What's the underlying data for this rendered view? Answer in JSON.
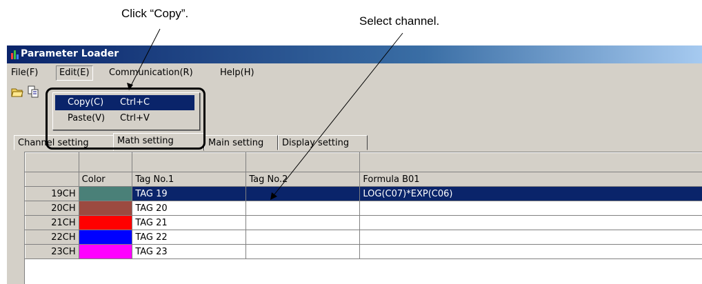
{
  "annotations": {
    "copy": "Click “Copy”.",
    "select": "Select channel."
  },
  "window": {
    "title": "Parameter Loader"
  },
  "menu": {
    "file": "File(F)",
    "edit": "Edit(E)",
    "communication": "Communication(R)",
    "help": "Help(H)"
  },
  "toolbar": {
    "icons": [
      "open-folder-icon",
      "copy-icon"
    ]
  },
  "edit_menu": {
    "copy": {
      "label": "Copy(C)",
      "shortcut": "Ctrl+C"
    },
    "paste": {
      "label": "Paste(V)",
      "shortcut": "Ctrl+V"
    }
  },
  "tabs": [
    "Channel setting",
    "Math setting",
    "Main setting",
    "Display setting"
  ],
  "grid": {
    "headers": [
      "Color",
      "Tag No.1",
      "Tag No.2",
      "Formula B01"
    ],
    "rows": [
      {
        "ch": "19CH",
        "color": "#4a8078",
        "tag1": "TAG 19",
        "tag2": "",
        "formula": "LOG(C07)*EXP(C06)"
      },
      {
        "ch": "20CH",
        "color": "#9c4a40",
        "tag1": "TAG 20",
        "tag2": "",
        "formula": ""
      },
      {
        "ch": "21CH",
        "color": "#ff0000",
        "tag1": "TAG 21",
        "tag2": "",
        "formula": ""
      },
      {
        "ch": "22CH",
        "color": "#0000ff",
        "tag1": "TAG 22",
        "tag2": "",
        "formula": ""
      },
      {
        "ch": "23CH",
        "color": "#ff00ff",
        "tag1": "TAG 23",
        "tag2": "",
        "formula": ""
      }
    ]
  }
}
